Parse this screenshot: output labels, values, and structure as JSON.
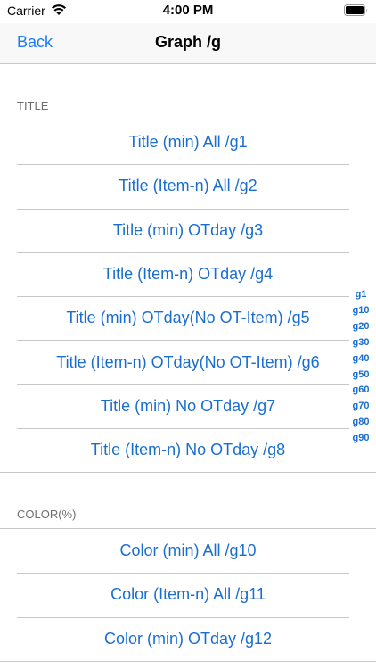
{
  "status_bar": {
    "carrier": "Carrier",
    "time": "4:00 PM",
    "wifi_icon": "wifi-icon",
    "battery_icon": "battery-icon"
  },
  "nav": {
    "back_label": "Back",
    "title": "Graph /g"
  },
  "sections": [
    {
      "header": "TITLE",
      "items": [
        "Title (min) All /g1",
        "Title (Item-n) All /g2",
        "Title (min) OTday /g3",
        "Title (Item-n) OTday /g4",
        "Title (min) OTday(No OT-Item) /g5",
        "Title (Item-n) OTday(No OT-Item) /g6",
        "Title (min) No OTday /g7",
        "Title (Item-n) No OTday /g8"
      ]
    },
    {
      "header": "COLOR(%)",
      "items": [
        "Color (min) All /g10",
        "Color (Item-n) All /g11",
        "Color (min) OTday /g12"
      ]
    }
  ],
  "index": [
    "g1",
    "g10",
    "g20",
    "g30",
    "g40",
    "g50",
    "g60",
    "g70",
    "g80",
    "g90"
  ],
  "colors": {
    "accent": "#1a7cf5",
    "cell_text": "#1a6ed0",
    "separator": "#c8c7cc",
    "section_header_text": "#6d6d72"
  }
}
